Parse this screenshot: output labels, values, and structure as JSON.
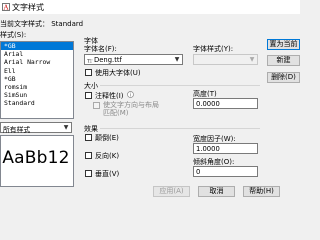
{
  "window": {
    "title": "文字样式"
  },
  "current_style": {
    "label": "当前文字样式：",
    "value": "Standard"
  },
  "styles": {
    "label": "样式(S):",
    "items": [
      "*GB",
      "Arial",
      "Arial Narrow",
      "Ell",
      "*GB",
      "romsim",
      "SimSun",
      "Standard"
    ],
    "selected_index": 0
  },
  "filter": {
    "value": "所有样式"
  },
  "font": {
    "group_label": "字体",
    "name_label": "字体名(F):",
    "name_value": "Deng.ttf",
    "style_label": "字体样式(Y):",
    "style_value": "",
    "bigfont_label": "使用大字体(U)"
  },
  "size": {
    "group_label": "大小",
    "annotative_label": "注释性(I)",
    "match_label_line1": "使文字方向与布局",
    "match_label_line2": "匹配(M)",
    "height_label": "高度(T)",
    "height_value": "0.0000"
  },
  "effects": {
    "group_label": "效果",
    "upside_down_label": "颠倒(E)",
    "backwards_label": "反向(K)",
    "vertical_label": "垂直(V)",
    "width_factor_label": "宽度因子(W):",
    "width_factor_value": "1.0000",
    "oblique_label": "倾斜角度(O):",
    "oblique_value": "0"
  },
  "preview": {
    "text": "AaBb12"
  },
  "buttons": {
    "set_current": "置为当前(C)",
    "new": "新建(N)...",
    "delete": "删除(D)",
    "apply": "应用(A)",
    "cancel": "取消",
    "help": "帮助(H)"
  },
  "colors": {
    "selection": "#0078d7",
    "default_border": "#0078d7"
  }
}
